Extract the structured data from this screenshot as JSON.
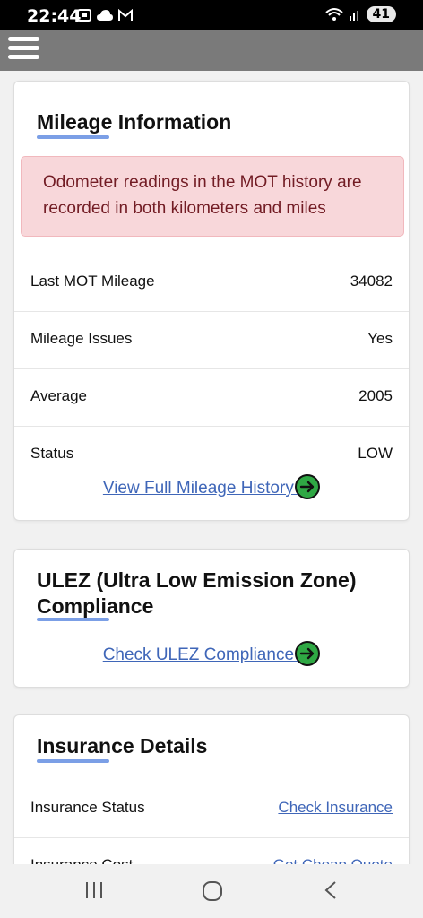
{
  "status_bar": {
    "time": "22:44",
    "battery": "41"
  },
  "mileage": {
    "title": "Mileage Information",
    "alert": "Odometer readings in the MOT history are recorded in both kilometers and miles",
    "rows": [
      {
        "label": "Last MOT Mileage",
        "value": "34082"
      },
      {
        "label": "Mileage Issues",
        "value": "Yes"
      },
      {
        "label": "Average",
        "value": "2005"
      },
      {
        "label": "Status",
        "value": "LOW"
      }
    ],
    "cta": "View Full Mileage History "
  },
  "ulez": {
    "title_line1": "ULEZ (Ultra Low Emission Zone)",
    "title_line2": "Compliance",
    "cta": "Check ULEZ Compliance "
  },
  "insurance": {
    "title": "Insurance Details",
    "rows": [
      {
        "label": "Insurance Status",
        "value": "Check Insurance"
      },
      {
        "label": "Insurance Cost",
        "value": "Get Cheap Quote"
      }
    ]
  },
  "colors": {
    "link": "#3f66b8",
    "accent_underline": "#7b9fe6",
    "alert_bg": "#f8d7da",
    "alert_text": "#721c24",
    "arrow_green": "#2fa844",
    "appbar": "#7a7a7a"
  }
}
